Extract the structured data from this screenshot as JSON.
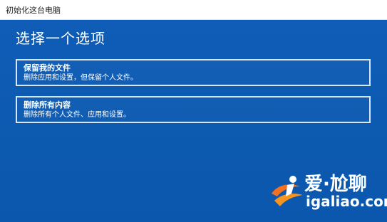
{
  "window": {
    "title": "初始化这台电脑"
  },
  "main": {
    "heading": "选择一个选项",
    "options": [
      {
        "title": "保留我的文件",
        "description": "删除应用和设置，但保留个人文件。"
      },
      {
        "title": "删除所有内容",
        "description": "删除所有个人文件、应用和设置。"
      }
    ]
  },
  "watermark": {
    "line1": "爱·尬聊",
    "line2": "igaliao.com",
    "icon": "swoosh-logo-icon"
  },
  "colors": {
    "background": "#0d5bb4",
    "option_border": "#d9e6f7",
    "text": "#ffffff",
    "watermark_accent": "#f37021"
  }
}
